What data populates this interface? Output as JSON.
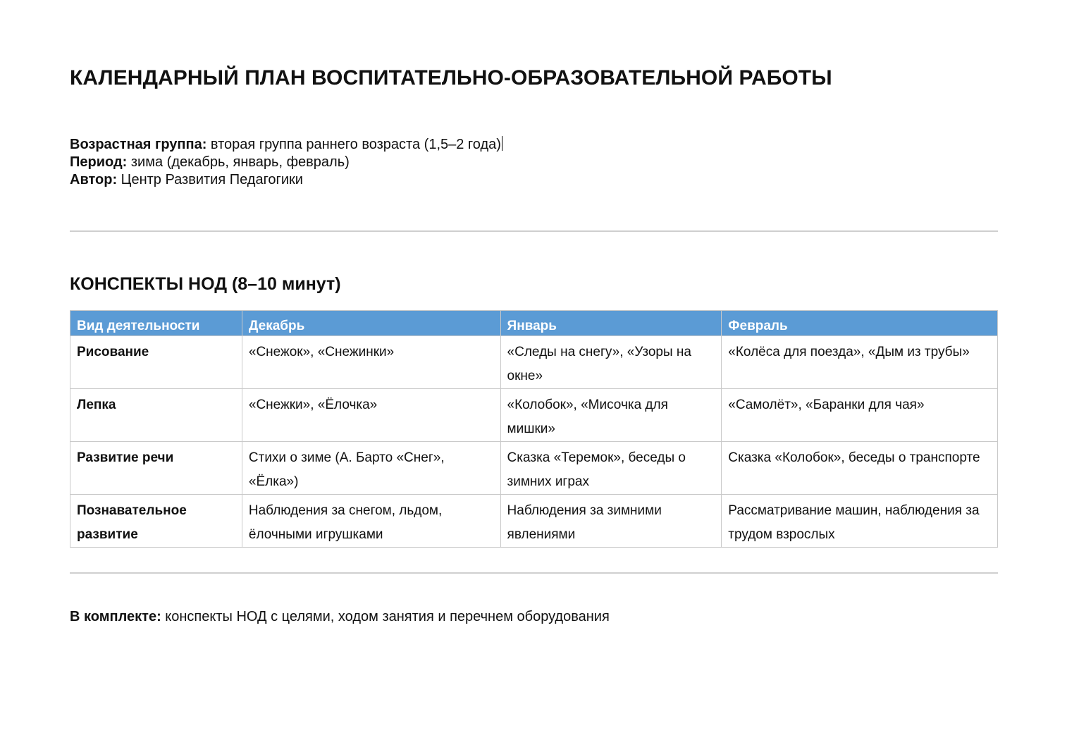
{
  "document": {
    "title": "КАЛЕНДАРНЫЙ ПЛАН ВОСПИТАТЕЛЬНО-ОБРАЗОВАТЕЛЬНОЙ РАБОТЫ",
    "meta": {
      "age_group_label": "Возрастная группа:",
      "age_group_value": " вторая группа раннего возраста (1,5–2 года)",
      "period_label": "Период:",
      "period_value": " зима (декабрь, январь, февраль)",
      "author_label": "Автор:",
      "author_value": " Центр Развития Педагогики"
    },
    "section_title": "КОНСПЕКТЫ НОД (8–10 минут)",
    "table": {
      "headers": [
        "Вид деятельности",
        "Декабрь",
        "Январь",
        "Февраль"
      ],
      "rows": [
        {
          "activity": "Рисование",
          "december": "«Снежок», «Снежинки»",
          "january": "«Следы на снегу», «Узоры на окне»",
          "february": "«Колёса для поезда», «Дым из трубы»"
        },
        {
          "activity": "Лепка",
          "december": "«Снежки», «Ёлочка»",
          "january": "«Колобок», «Мисочка для мишки»",
          "february": "«Самолёт», «Баранки для чая»"
        },
        {
          "activity": "Развитие речи",
          "december": "Стихи о зиме (А. Барто «Снег», «Ёлка»)",
          "january": "Сказка «Теремок», беседы о зимних играх",
          "february": "Сказка «Колобок», беседы о транспорте"
        },
        {
          "activity": "Познавательное развитие",
          "december": "Наблюдения за снегом, льдом, ёлочными игрушками",
          "january": "Наблюдения за зимними явлениями",
          "february": "Рассматривание машин, наблюдения за трудом взрослых"
        }
      ]
    },
    "footer": {
      "label": "В комплекте:",
      "value": " конспекты НОД с целями, ходом занятия и перечнем оборудования"
    },
    "colors": {
      "table_header_bg": "#5b9bd5",
      "table_header_text": "#ffffff",
      "rule": "#cfcfcf",
      "cell_border": "#c9c9c9"
    }
  }
}
